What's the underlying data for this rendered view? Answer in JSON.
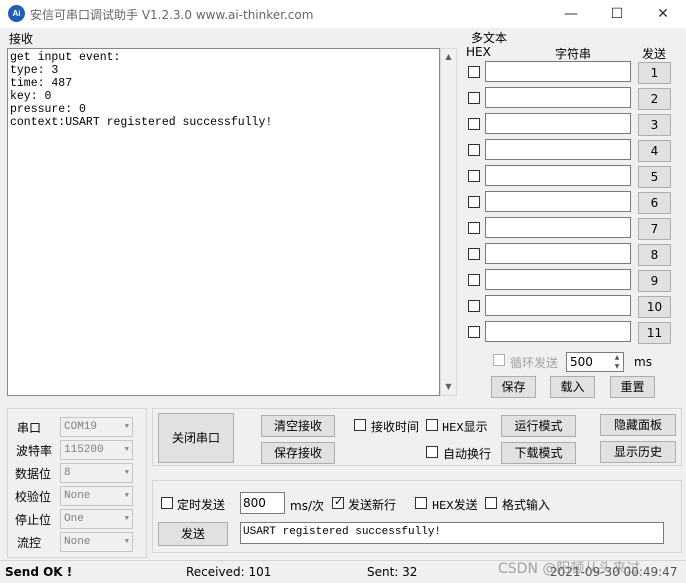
{
  "window": {
    "title": "安信可串口调试助手 V1.2.3.0     www.ai-thinker.com",
    "icon_text": "Ai",
    "minimize_icon": "minimize-icon",
    "maximize_icon": "maximize-icon",
    "close_icon": "close-icon"
  },
  "receive": {
    "label": "接收",
    "text": "get input event:\ntype: 3\ntime: 487\nkey: 0\npressure: 0\ncontext:USART registered successfully!"
  },
  "multi": {
    "title": "多文本",
    "hex_header": "HEX",
    "string_header": "字符串",
    "send_header": "发送",
    "rows": [
      {
        "num": "1",
        "value": "",
        "hex": false
      },
      {
        "num": "2",
        "value": "",
        "hex": false
      },
      {
        "num": "3",
        "value": "",
        "hex": false
      },
      {
        "num": "4",
        "value": "",
        "hex": false
      },
      {
        "num": "5",
        "value": "",
        "hex": false
      },
      {
        "num": "6",
        "value": "",
        "hex": false
      },
      {
        "num": "7",
        "value": "",
        "hex": false
      },
      {
        "num": "8",
        "value": "",
        "hex": false
      },
      {
        "num": "9",
        "value": "",
        "hex": false
      },
      {
        "num": "10",
        "value": "",
        "hex": false
      },
      {
        "num": "11",
        "value": "",
        "hex": false
      }
    ],
    "loop_label": "循环发送",
    "loop_checked": false,
    "loop_interval": "500",
    "loop_unit": "ms",
    "save_btn": "保存",
    "load_btn": "载入",
    "reset_btn": "重置"
  },
  "serial": {
    "port_label": "串口",
    "port_value": "COM19",
    "baud_label": "波特率",
    "baud_value": "115200",
    "data_label": "数据位",
    "data_value": "8",
    "parity_label": "校验位",
    "parity_value": "None",
    "stop_label": "停止位",
    "stop_value": "One",
    "flow_label": "流控",
    "flow_value": "None"
  },
  "controls": {
    "close_port": "关闭串口",
    "clear_recv": "清空接收",
    "save_recv": "保存接收",
    "recv_time_label": "接收时间",
    "recv_time_checked": false,
    "hex_display_label": "HEX显示",
    "hex_display_checked": false,
    "auto_wrap_label": "自动换行",
    "auto_wrap_checked": false,
    "run_mode": "运行模式",
    "download_mode": "下载模式",
    "hide_panel": "隐藏面板",
    "show_history": "显示历史"
  },
  "send": {
    "timed_label": "定时发送",
    "timed_checked": false,
    "interval": "800",
    "interval_unit": "ms/次",
    "newline_label": "发送新行",
    "newline_checked": true,
    "hex_send_label": "HEX发送",
    "hex_send_checked": false,
    "format_input_label": "格式输入",
    "format_input_checked": false,
    "send_btn": "发送",
    "send_text": "USART registered successfully!"
  },
  "status": {
    "send_ok": "Send OK !",
    "received": "Received: 101",
    "sent": "Sent: 32",
    "datetime": "2021-09-30 00:49:47",
    "watermark": "CSDN @阳顿从头来过"
  }
}
